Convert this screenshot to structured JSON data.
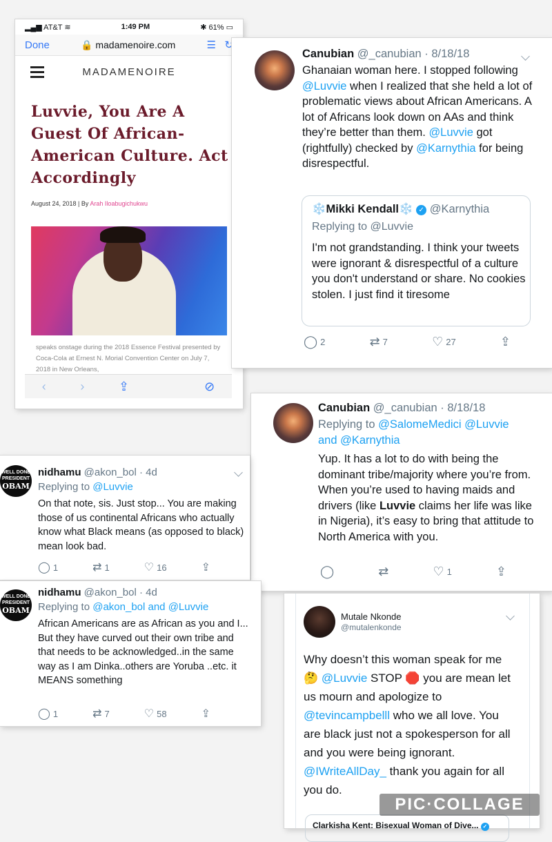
{
  "phone": {
    "status": {
      "carrier": "AT&T",
      "time": "1:49 PM",
      "battery": "61%"
    },
    "address_bar": {
      "done": "Done",
      "url": "madamenoire.com"
    },
    "site_logo": "MADAMENOIRE",
    "headline_lines": [
      "Luvvie, You Are A",
      "Guest Of African-",
      "American Culture. Act",
      "Accordingly"
    ],
    "date_by": "August 24, 2018 | By",
    "author": "Arah Iloabugichukwu",
    "caption": "speaks onstage during the 2018 Essence Festival presented by Coca-Cola at Ernest N. Morial Convention Center on July 7, 2018 in New Orleans,"
  },
  "tweet1": {
    "name": "Canubian",
    "handle": "@_canubian · 8/18/18",
    "text_parts": [
      "Ghanaian woman here. I stopped following ",
      "@Luvvie",
      " when I realized that she held a lot of problematic views about African Americans. A lot of Africans look down on AAs and think they’re better than them. ",
      "@Luvvie",
      " got (rightfully) checked by ",
      "@Karnythia",
      " for being disrespectful."
    ],
    "quote": {
      "name": "❄️Mikki Kendall❄️",
      "handle": "@Karnythia",
      "replying_prefix": "Replying to ",
      "replying_to": "@Luvvie",
      "text": "I'm not grandstanding. I think your tweets were ignorant & disrespectful of a culture you don't understand or share. No cookies stolen. I just find it tiresome"
    },
    "replies": "2",
    "retweets": "7",
    "likes": "27"
  },
  "tweet2": {
    "name": "Canubian",
    "handle": "@_canubian · 8/18/18",
    "replying_prefix": "Replying to ",
    "replying_to": "@SalomeMedici @Luvvie",
    "replying_and": "and ",
    "replying_last": "@Karnythia",
    "text_parts": [
      "Yup. It has a lot to do with being the dominant tribe/majority where you’re from. When you’re used to having maids and drivers (like ",
      "Luvvie",
      " claims her life was like in Nigeria), it’s easy to bring that attitude to North America with you."
    ],
    "likes": "1"
  },
  "tweet3": {
    "avatar_lines": [
      "WELL DONE",
      "PRESIDENT",
      "OBAM"
    ],
    "name": "nidhamu",
    "handle": "@akon_bol · 4d",
    "replying_prefix": "Replying to ",
    "replying_to": "@Luvvie",
    "text": "On that note, sis. Just stop... You are making those of us continental Africans who actually know what Black means (as opposed to black) mean look bad.",
    "replies": "1",
    "retweets": "1",
    "likes": "16"
  },
  "tweet4": {
    "avatar_lines": [
      "WELL DONE",
      "PRESIDENT",
      "OBAM"
    ],
    "name": "nidhamu",
    "handle": "@akon_bol · 4d",
    "replying_prefix": "Replying to ",
    "replying_to": "@akon_bol and @Luvvie",
    "text": "African Americans are as African as you and I... But they have curved out their own tribe and that needs to be acknowledged..in the same way as I am Dinka..others are Yoruba ..etc. it MEANS something",
    "replies": "1",
    "retweets": "7",
    "likes": "58"
  },
  "tweet5": {
    "name": "Mutale Nkonde",
    "handle": "@mutalenkonde",
    "text_parts": [
      "Why doesn’t this woman speak for me 🤔 ",
      "@Luvvie",
      " STOP 🛑 you are mean let us mourn and apologize to ",
      "@tevincampbelll",
      " who we all love. You are black just not a spokesperson for all and you were being ignorant. ",
      "@IWriteAllDay_",
      " thank you again for all you do."
    ],
    "quote_name": "Clarkisha Kent: Bisexual Woman of Dive..."
  },
  "watermark": "PIC·COLLAGE",
  "colors": {
    "twitter_blue": "#1da1f2",
    "headline": "#6b1b2b",
    "author_pink": "#e0458f",
    "safari_blue": "#3478f6"
  }
}
